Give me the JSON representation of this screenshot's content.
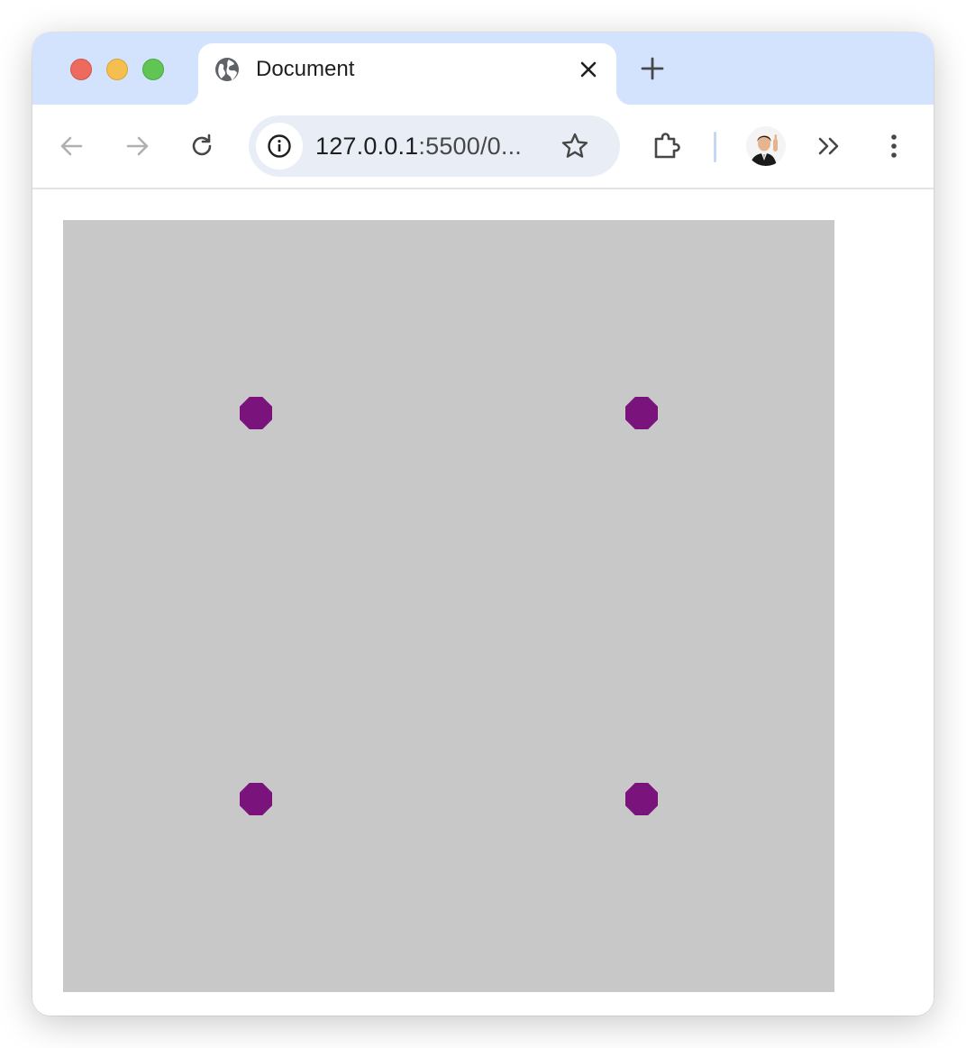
{
  "tab": {
    "title": "Document",
    "favicon": "globe-icon"
  },
  "toolbar": {
    "url_host": "127.0.0.1",
    "url_rest": ":5500/0..."
  },
  "colors": {
    "tabstrip": "#d3e3fd",
    "canvas_background": "#c8c8c8",
    "dot": "#7b137d"
  },
  "icons": {
    "back": "arrow-left-icon",
    "forward": "arrow-right-icon",
    "reload": "reload-icon",
    "site_info": "info-icon",
    "bookmark": "star-icon",
    "extensions": "puzzle-icon",
    "overflow": "chevron-double-right-icon",
    "menu": "kebab-menu-icon"
  }
}
